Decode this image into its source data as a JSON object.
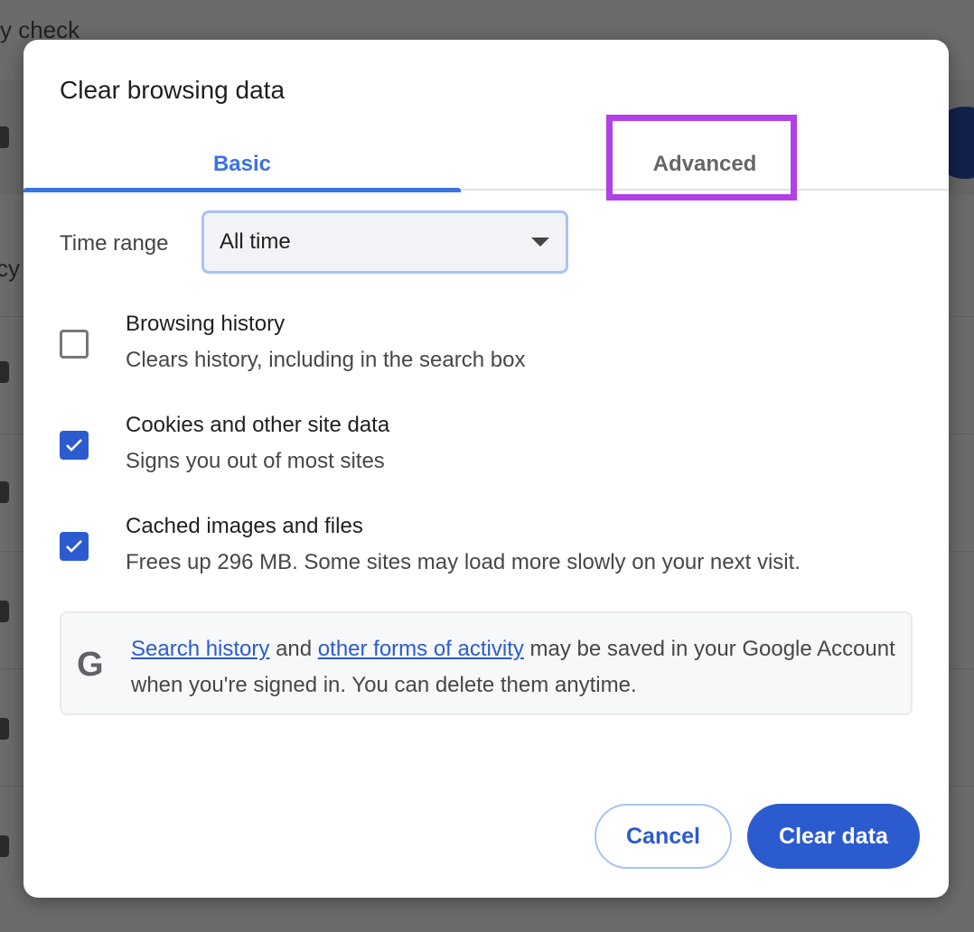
{
  "background": {
    "partial_text_1": "y check",
    "partial_text_2": "cy"
  },
  "dialog": {
    "title": "Clear browsing data",
    "tabs": [
      {
        "label": "Basic",
        "active": true
      },
      {
        "label": "Advanced",
        "active": false,
        "highlighted": true
      }
    ],
    "time_range": {
      "label": "Time range",
      "value": "All time"
    },
    "options": [
      {
        "title": "Browsing history",
        "description": "Clears history, including in the search box",
        "checked": false
      },
      {
        "title": "Cookies and other site data",
        "description": "Signs you out of most sites",
        "checked": true
      },
      {
        "title": "Cached images and files",
        "description": "Frees up 296 MB. Some sites may load more slowly on your next visit.",
        "checked": true
      }
    ],
    "info": {
      "icon": "google-g-icon",
      "link1": "Search history",
      "and": " and ",
      "link2": "other forms of activity",
      "rest": " may be saved in your Google Account when you're signed in. You can delete them anytime."
    },
    "buttons": {
      "cancel": "Cancel",
      "clear": "Clear data"
    }
  },
  "colors": {
    "accent": "#2c5bcf",
    "highlight": "#b240e8"
  }
}
